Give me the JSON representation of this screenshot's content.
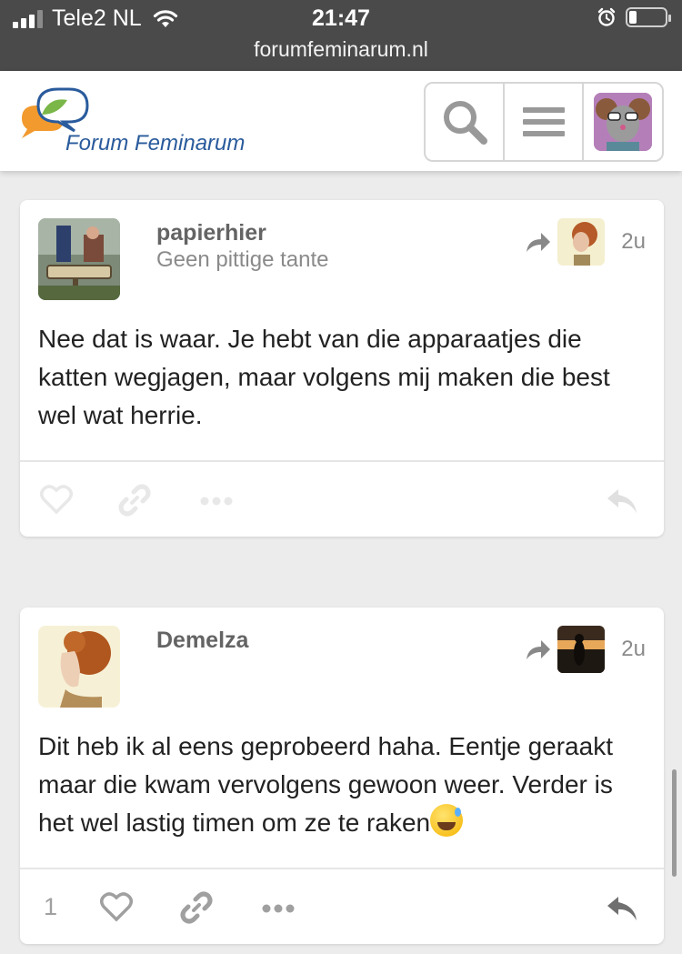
{
  "status_bar": {
    "carrier": "Tele2 NL",
    "time": "21:47",
    "url": "forumfeminarum.nl"
  },
  "header": {
    "logo_text": "Forum Feminarum",
    "search_icon": "search-icon",
    "menu_icon": "hamburger-menu-icon",
    "colors": {
      "logo_blue": "#2a5b9c",
      "logo_orange": "#f29a2e",
      "logo_green": "#7ab648"
    }
  },
  "posts": [
    {
      "username": "papierhier",
      "user_title": "Geen pittige tante",
      "age": "2u",
      "body": "Nee dat is waar. Je hebt van die apparaatjes die katten wegjagen, maar volgens mij maken die best wel wat herrie.",
      "like_count": "",
      "actions": [
        "heart-icon",
        "link-icon",
        "more-icon",
        "reply-icon"
      ]
    },
    {
      "username": "Demelza",
      "user_title": "",
      "age": "2u",
      "body": "Dit heb ik al eens geprobeerd haha. Eentje geraakt maar die kwam vervolgens gewoon weer. Verder is het wel lastig timen om ze te raken",
      "emoji": "sweat-smile-emoji",
      "like_count": "1",
      "actions": [
        "heart-icon",
        "link-icon",
        "more-icon",
        "reply-icon"
      ]
    }
  ]
}
